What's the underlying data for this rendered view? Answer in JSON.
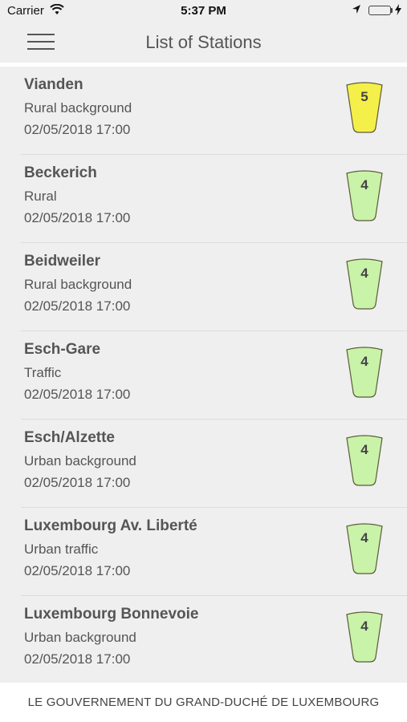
{
  "status_bar": {
    "carrier": "Carrier",
    "time": "5:37 PM"
  },
  "nav": {
    "title": "List of Stations"
  },
  "colors": {
    "index_5": "#f5ef4a",
    "index_4": "#c9f3a8",
    "badge_stroke": "#5a5a3a"
  },
  "stations": [
    {
      "name": "Vianden",
      "type": "Rural background",
      "date": "02/05/2018 17:00",
      "index": "5"
    },
    {
      "name": "Beckerich",
      "type": "Rural",
      "date": "02/05/2018 17:00",
      "index": "4"
    },
    {
      "name": "Beidweiler",
      "type": "Rural background",
      "date": "02/05/2018 17:00",
      "index": "4"
    },
    {
      "name": "Esch-Gare",
      "type": "Traffic",
      "date": "02/05/2018 17:00",
      "index": "4"
    },
    {
      "name": "Esch/Alzette",
      "type": "Urban background",
      "date": "02/05/2018 17:00",
      "index": "4"
    },
    {
      "name": "Luxembourg Av. Liberté",
      "type": "Urban traffic",
      "date": "02/05/2018 17:00",
      "index": "4"
    },
    {
      "name": "Luxembourg Bonnevoie",
      "type": "Urban background",
      "date": "02/05/2018 17:00",
      "index": "4"
    }
  ],
  "footer": {
    "text": "LE GOUVERNEMENT DU GRAND-DUCHÉ DE LUXEMBOURG"
  }
}
